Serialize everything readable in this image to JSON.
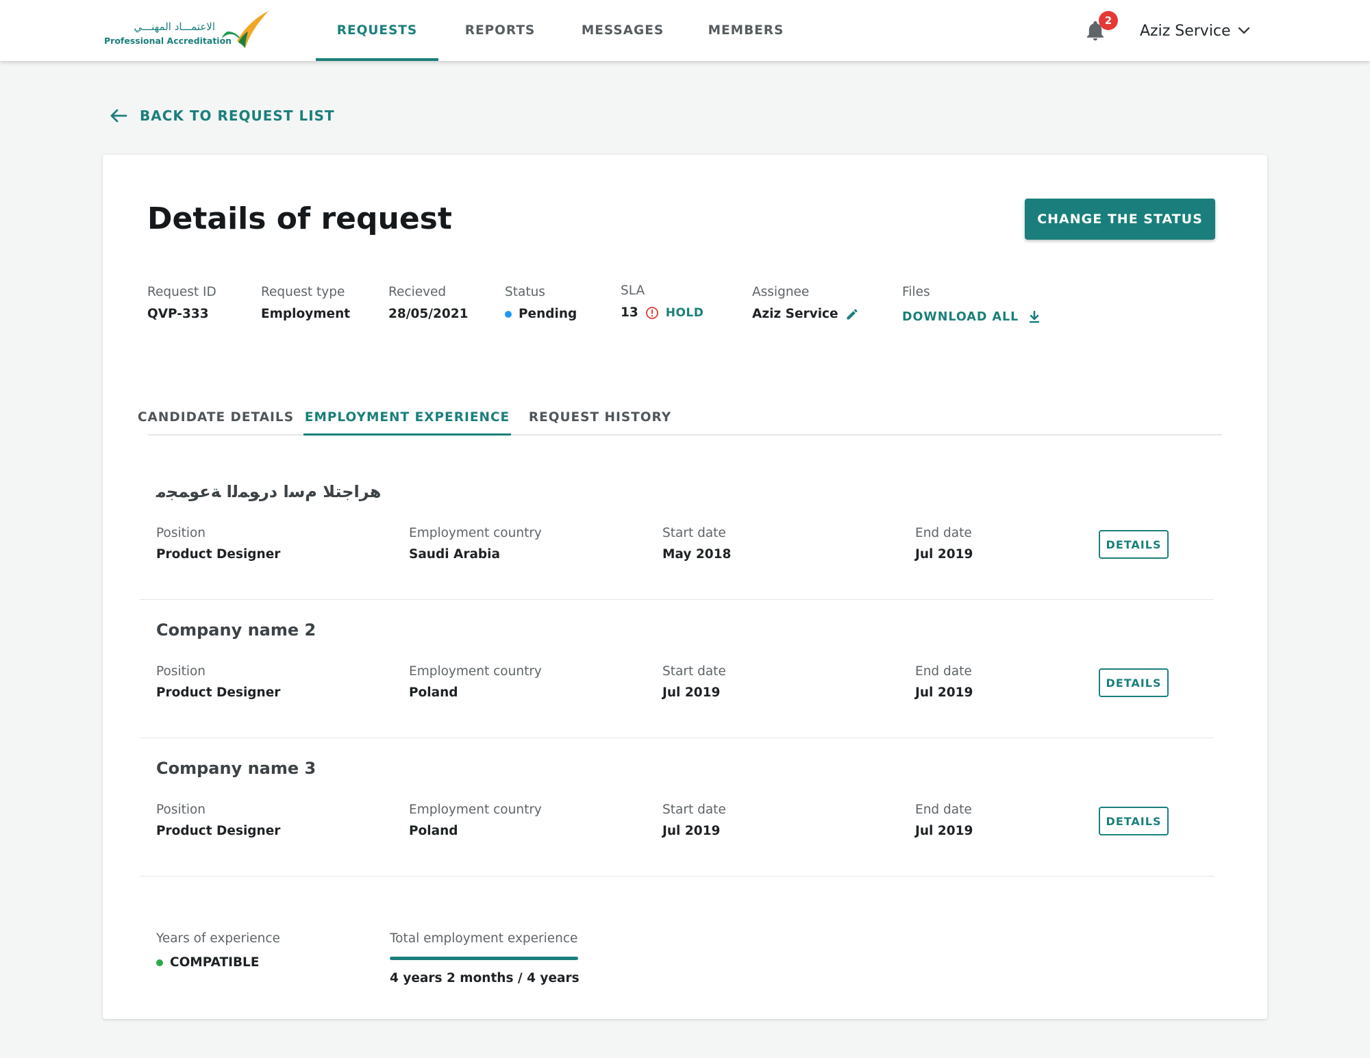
{
  "app": {
    "logo": {
      "arabic": "الاعتمـــاد المهنـــي",
      "english": "Professional Accreditation"
    },
    "nav": [
      {
        "label": "REQUESTS",
        "active": true
      },
      {
        "label": "REPORTS",
        "active": false
      },
      {
        "label": "MESSAGES",
        "active": false
      },
      {
        "label": "MEMBERS",
        "active": false
      }
    ],
    "notifications": {
      "icon": "bell-icon",
      "count": "2"
    },
    "user": {
      "name": "Aziz Service",
      "icon": "chevron-down-icon"
    }
  },
  "back_link": {
    "label": "BACK TO REQUEST LIST",
    "icon": "arrow-left-icon"
  },
  "request": {
    "title": "Details of request",
    "change_status_label": "CHANGE THE STATUS",
    "meta": {
      "id": {
        "label": "Request ID",
        "value": "QVP-333"
      },
      "type": {
        "label": "Request type",
        "value": "Employment"
      },
      "received": {
        "label": "Recieved",
        "value": "28/05/2021"
      },
      "status": {
        "label": "Status",
        "value": "Pending",
        "color": "#2196f3"
      },
      "sla": {
        "label": "SLA",
        "value": "13",
        "hold": "HOLD",
        "alert_color": "#e53935"
      },
      "assignee": {
        "label": "Assignee",
        "value": "Aziz Service",
        "icon": "pencil-icon"
      },
      "files": {
        "label": "Files",
        "link": "DOWNLOAD ALL",
        "icon": "download-icon"
      }
    }
  },
  "tabs": [
    {
      "label": "CANDIDATE DETAILS",
      "active": false
    },
    {
      "label": "EMPLOYMENT EXPERIENCE",
      "active": true
    },
    {
      "label": "REQUEST HISTORY",
      "active": false
    }
  ],
  "employment": {
    "field_labels": {
      "position": "Position",
      "country": "Employment country",
      "start": "Start date",
      "end": "End date"
    },
    "details_label": "DETAILS",
    "entries": [
      {
        "company": "هراجتلا مﺳا درﻮﻤﻟا ﺔﻋﻮﻤﺠﻣ",
        "position": "Product Designer",
        "country": "Saudi Arabia",
        "start": "May 2018",
        "end": "Jul 2019"
      },
      {
        "company": "Company name 2",
        "position": "Product Designer",
        "country": "Poland",
        "start": "Jul 2019",
        "end": "Jul 2019"
      },
      {
        "company": "Company name 3",
        "position": "Product Designer",
        "country": "Poland",
        "start": "Jul 2019",
        "end": "Jul 2019"
      }
    ]
  },
  "summary": {
    "years": {
      "label": "Years of experience",
      "value": "COMPATIBLE",
      "color": "#2fa84f"
    },
    "total": {
      "label": "Total employment experience",
      "value": "4 years 2 months / 4 years",
      "progress": 1.0
    }
  },
  "colors": {
    "accent": "#1a7f7c",
    "badge": "#e53935"
  }
}
